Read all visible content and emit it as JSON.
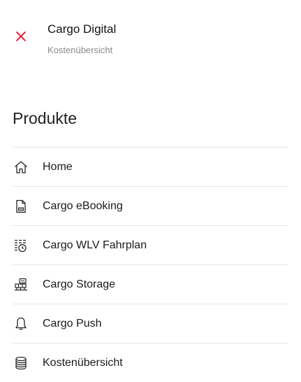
{
  "header": {
    "title": "Cargo Digital",
    "subtitle": "Kostenübersicht",
    "close_icon": "close-icon",
    "accent_color": "#e2001a"
  },
  "products": {
    "heading": "Produkte",
    "items": [
      {
        "label": "Home",
        "icon": "home-icon"
      },
      {
        "label": "Cargo eBooking",
        "icon": "document-icon"
      },
      {
        "label": "Cargo WLV Fahrplan",
        "icon": "schedule-clock-icon"
      },
      {
        "label": "Cargo Storage",
        "icon": "storage-icon"
      },
      {
        "label": "Cargo Push",
        "icon": "bell-icon"
      },
      {
        "label": "Kostenübersicht",
        "icon": "coins-stack-icon"
      }
    ]
  }
}
